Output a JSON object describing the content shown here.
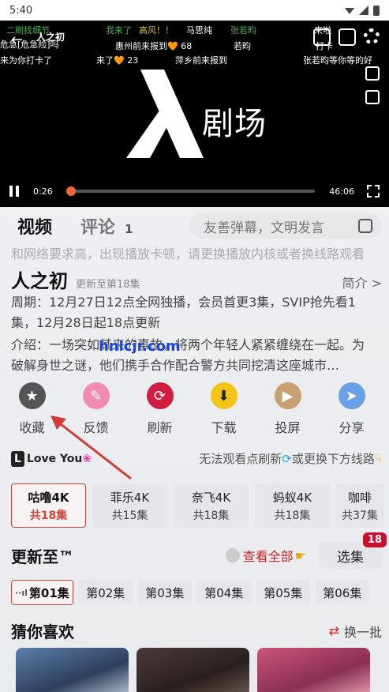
{
  "status_bar": {
    "time": "5:40"
  },
  "video": {
    "overlay_title": "人之初",
    "logo_text": "剧场",
    "current_time": "0:26",
    "total_time": "46:06",
    "progress": 0.017,
    "danmaku": [
      {
        "text": "二刷找细节",
        "color": "#4caf50"
      },
      {
        "text": "我来了",
        "color": "#4caf50"
      },
      {
        "text": "高风！！",
        "color": "#e0c020"
      },
      {
        "text": "马思纯",
        "color": "#ffffff"
      },
      {
        "text": "张若昀",
        "color": "#4caf50"
      },
      {
        "text": "来啦",
        "color": "#ffffff"
      },
      {
        "text": "危急[危急险]吗",
        "color": "#ffffff"
      },
      {
        "text": "惠州前来报到🧡 68",
        "color": "#ffffff"
      },
      {
        "text": "若昀",
        "color": "#ffffff"
      },
      {
        "text": "打卡",
        "color": "#ffffff"
      },
      {
        "text": "来为你打卡了",
        "color": "#ffffff"
      },
      {
        "text": "来了🧡 23",
        "color": "#ffffff"
      },
      {
        "text": "萍乡前来报到",
        "color": "#ffffff"
      },
      {
        "text": "张若昀等你等的好",
        "color": "#ffffff"
      }
    ]
  },
  "tabs": {
    "video": "视频",
    "comment": "评论",
    "comment_count": "1"
  },
  "danmu_input": {
    "placeholder": "友善弹幕，文明发言"
  },
  "notice": "和网络要求高，出现播放卡顿，请更换播放内核或者换线路观看",
  "show": {
    "title": "人之初",
    "updated": "更新至第18集",
    "intro_link": "简介 >",
    "schedule": "周期：12月27日12点全网独播，会员首更3集，SVIP抢先看1集，12月28日起18点更新",
    "summary": "介绍：一场突如其来的事故，将两个年轻人紧紧缠绕在一起。为破解身世之谜，他们携手合作配合警方共同挖清这座城市…",
    "watermark": "hnlcjr.com"
  },
  "actions": [
    {
      "label": "收藏",
      "icon": "star-icon",
      "color": "#555555"
    },
    {
      "label": "反馈",
      "icon": "pencil-icon",
      "color": "#f28bb0"
    },
    {
      "label": "刷新",
      "icon": "refresh-icon",
      "color": "#d11d3f"
    },
    {
      "label": "下载",
      "icon": "download-icon",
      "color": "#f2c518"
    },
    {
      "label": "投屏",
      "icon": "tv-icon",
      "color": "#c9a070"
    },
    {
      "label": "分享",
      "icon": "share-icon",
      "color": "#6aa0e8"
    }
  ],
  "source_hint": {
    "love_text": "Love You",
    "text_before": "无法观看点刷新",
    "text_after": "或更换下方线路"
  },
  "sources": [
    {
      "name": "咕噜4K",
      "eps": "共18集",
      "active": true
    },
    {
      "name": "菲乐4K",
      "eps": "共15集",
      "active": false
    },
    {
      "name": "奈飞4K",
      "eps": "共18集",
      "active": false
    },
    {
      "name": "蚂蚁4K",
      "eps": "共18集",
      "active": false
    },
    {
      "name": "咖啡",
      "eps": "共37集",
      "active": false
    }
  ],
  "updates": {
    "title": "更新至™",
    "see_all": "查看全部",
    "pick": "选集",
    "badge": "18",
    "episodes": [
      "第01集",
      "第02集",
      "第03集",
      "第04集",
      "第05集",
      "第06集"
    ]
  },
  "guess": {
    "title": "猜你喜欢",
    "swap": "换一批"
  },
  "colors": {
    "accent": "#d0262a",
    "progress": "#f27a1a"
  }
}
